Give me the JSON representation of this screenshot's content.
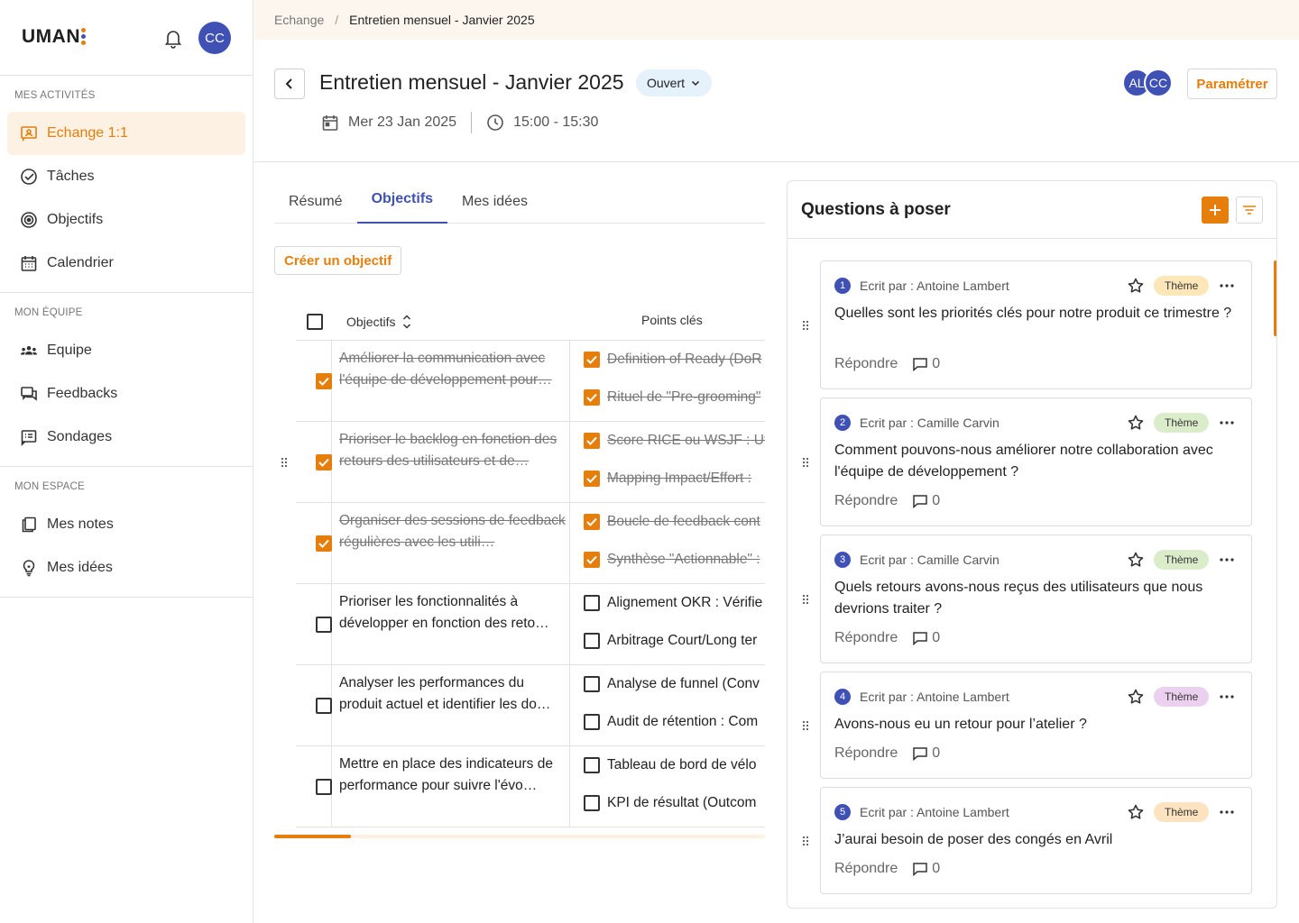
{
  "app": {
    "logo": "UMAN",
    "user_initials": "CC"
  },
  "sidebar": {
    "sections": [
      {
        "heading": "MES ACTIVITÉS",
        "items": [
          {
            "label": "Echange 1:1",
            "icon": "chat-person-icon",
            "active": true
          },
          {
            "label": "Tâches",
            "icon": "check-circle-icon"
          },
          {
            "label": "Objectifs",
            "icon": "target-icon"
          },
          {
            "label": "Calendrier",
            "icon": "calendar-icon"
          }
        ]
      },
      {
        "heading": "MON ÉQUIPE",
        "items": [
          {
            "label": "Equipe",
            "icon": "group-icon"
          },
          {
            "label": "Feedbacks",
            "icon": "feedback-icon"
          },
          {
            "label": "Sondages",
            "icon": "survey-icon"
          }
        ]
      },
      {
        "heading": "MON ESPACE",
        "items": [
          {
            "label": "Mes notes",
            "icon": "notes-icon"
          },
          {
            "label": "Mes idées",
            "icon": "lightbulb-icon"
          }
        ]
      }
    ]
  },
  "breadcrumb": {
    "parent": "Echange",
    "separator": "/",
    "current": "Entretien mensuel - Janvier 2025"
  },
  "header": {
    "title": "Entretien mensuel - Janvier 2025",
    "status": "Ouvert",
    "date": "Mer 23 Jan 2025",
    "time": "15:00 - 15:30",
    "participants": [
      "AL",
      "CC"
    ],
    "settings_label": "Paramétrer"
  },
  "tabs": [
    {
      "label": "Résumé",
      "active": false
    },
    {
      "label": "Objectifs",
      "active": true
    },
    {
      "label": "Mes idées",
      "active": false
    }
  ],
  "create_objective_label": "Créer un objectif",
  "objectives_table": {
    "headers": {
      "objectives": "Objectifs",
      "key_points": "Points clés"
    },
    "rows": [
      {
        "done": true,
        "objective": "Améliorer la communication avec l'équipe de développement pour…",
        "key_points": [
          {
            "done": true,
            "label": "Definition of Ready (DoR"
          },
          {
            "done": true,
            "label": "Rituel de \"Pre-grooming\""
          }
        ]
      },
      {
        "done": true,
        "objective": "Prioriser le backlog en fonction des retours des utilisateurs et de…",
        "key_points": [
          {
            "done": true,
            "label": "Score RICE ou WSJF : Ut"
          },
          {
            "done": true,
            "label": "Mapping Impact/Effort :"
          }
        ]
      },
      {
        "done": true,
        "objective": "Organiser des sessions de feedback régulières avec les utili…",
        "key_points": [
          {
            "done": true,
            "label": "Boucle de feedback cont"
          },
          {
            "done": true,
            "label": "Synthèse \"Actionnable\" :"
          }
        ]
      },
      {
        "done": false,
        "objective": "Prioriser les fonctionnalités à développer en fonction des reto…",
        "key_points": [
          {
            "done": false,
            "label": "Alignement OKR : Vérifie"
          },
          {
            "done": false,
            "label": "Arbitrage Court/Long ter"
          }
        ]
      },
      {
        "done": false,
        "objective": "Analyser les performances du produit actuel et identifier les do…",
        "key_points": [
          {
            "done": false,
            "label": "Analyse de funnel (Conv"
          },
          {
            "done": false,
            "label": "Audit de rétention : Com"
          }
        ]
      },
      {
        "done": false,
        "objective": "Mettre en place des indicateurs de performance pour suivre l'évo…",
        "key_points": [
          {
            "done": false,
            "label": "Tableau de bord de vélo"
          },
          {
            "done": false,
            "label": "KPI de résultat (Outcom"
          }
        ]
      }
    ]
  },
  "questions": {
    "title": "Questions à poser",
    "reply_label": "Répondre",
    "items": [
      {
        "num": "1",
        "author": "Ecrit par : Antoine Lambert",
        "theme": "Thème",
        "theme_color": "#fde7b8",
        "text": "Quelles sont les priorités clés pour notre produit ce trimestre ?",
        "comments": "0"
      },
      {
        "num": "2",
        "author": "Ecrit par : Camille Carvin",
        "theme": "Thème",
        "theme_color": "#dbeccb",
        "text": "Comment pouvons-nous améliorer notre collaboration avec l'équipe de développement ?",
        "comments": "0"
      },
      {
        "num": "3",
        "author": "Ecrit par : Camille Carvin",
        "theme": "Thème",
        "theme_color": "#dbeccb",
        "text": "Quels retours avons-nous reçus des utilisateurs que nous devrions traiter ?",
        "comments": "0"
      },
      {
        "num": "4",
        "author": "Ecrit par : Antoine Lambert",
        "theme": "Thème",
        "theme_color": "#ecd0ef",
        "text": "Avons-nous eu un retour pour l’atelier ?",
        "comments": "0"
      },
      {
        "num": "5",
        "author": "Ecrit par : Antoine Lambert",
        "theme": "Thème",
        "theme_color": "#fde3bf",
        "text": "J’aurai besoin de poser des congés en Avril",
        "comments": "0"
      }
    ]
  },
  "colors": {
    "accent": "#e67e0c",
    "primary": "#3f51b5",
    "breadcrumb_bg": "#fdf6ee",
    "status_bg": "#e5f1fb"
  }
}
